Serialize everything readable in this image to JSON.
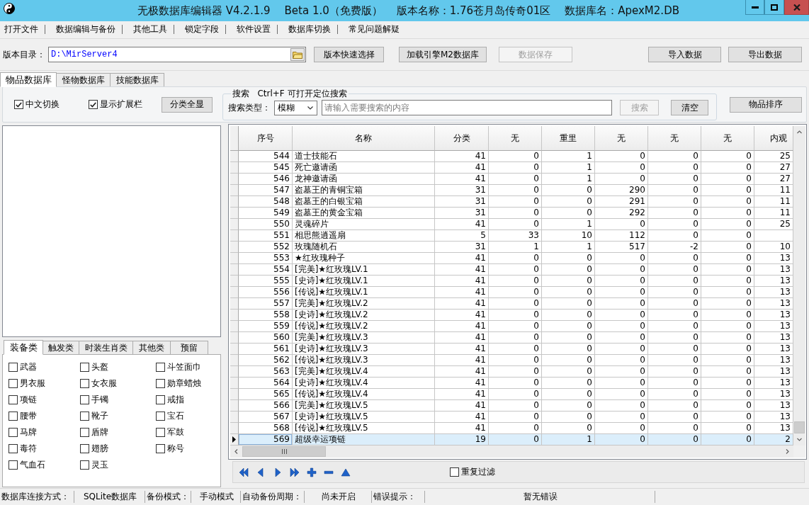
{
  "window": {
    "title": "无极数据库编辑器 V4.2.1.9",
    "edition": "Beta 1.0（免费版）",
    "version_name": "版本名称：1.76苍月岛传奇01区",
    "database_name": "数据库名：ApexM2.DB"
  },
  "menu": [
    "打开文件",
    "数据编辑与备份",
    "其他工具",
    "锁定字段",
    "软件设置",
    "数据库切换",
    "常见问题解疑"
  ],
  "toolbar": {
    "path_label": "版本目录：",
    "path_value": "D:\\MirServer4",
    "left_buttons": [
      {
        "label": "版本快速选择",
        "disabled": false
      },
      {
        "label": "加载引擎M2数据库",
        "disabled": false
      },
      {
        "label": "数据保存",
        "disabled": true
      }
    ],
    "right_buttons": [
      {
        "label": "导入数据",
        "disabled": false
      },
      {
        "label": "导出数据",
        "disabled": false
      }
    ]
  },
  "tabs": [
    {
      "label": "物品数据库",
      "selected": true
    },
    {
      "label": "怪物数据库",
      "selected": false
    },
    {
      "label": "技能数据库",
      "selected": false
    }
  ],
  "options": {
    "checkboxes": [
      {
        "label": "中文切换",
        "checked": true
      },
      {
        "label": "显示扩展栏",
        "checked": true
      }
    ],
    "show_all_button": "分类全显",
    "search": {
      "title": "搜索   Ctrl+F 可打开定位搜索",
      "type_label": "搜索类型：",
      "type_value": "模糊",
      "placeholder": "请输入需要搜索的内容",
      "search_button": {
        "label": "搜索",
        "disabled": true
      },
      "clear_button": {
        "label": "清空",
        "disabled": false
      }
    },
    "sort_button": "物品排序"
  },
  "category_tabs": [
    {
      "label": "装备类",
      "selected": true
    },
    {
      "label": "触发类",
      "selected": false
    },
    {
      "label": "时装生肖类",
      "selected": false
    },
    {
      "label": "其他类",
      "selected": false
    },
    {
      "label": "预留",
      "selected": false
    }
  ],
  "categories": [
    {
      "label": "武器",
      "checked": false
    },
    {
      "label": "头盔",
      "checked": false
    },
    {
      "label": "斗笠面巾",
      "checked": false
    },
    {
      "label": "男衣服",
      "checked": false
    },
    {
      "label": "女衣服",
      "checked": false
    },
    {
      "label": "勋章蜡烛",
      "checked": false
    },
    {
      "label": "项链",
      "checked": false
    },
    {
      "label": "手镯",
      "checked": false
    },
    {
      "label": "戒指",
      "checked": false
    },
    {
      "label": "腰带",
      "checked": false
    },
    {
      "label": "靴子",
      "checked": false
    },
    {
      "label": "宝石",
      "checked": false
    },
    {
      "label": "马牌",
      "checked": false
    },
    {
      "label": "盾牌",
      "checked": false
    },
    {
      "label": "军鼓",
      "checked": false
    },
    {
      "label": "毒符",
      "checked": false
    },
    {
      "label": "翅膀",
      "checked": false
    },
    {
      "label": "称号",
      "checked": false
    },
    {
      "label": "气血石",
      "checked": false
    },
    {
      "label": "灵玉",
      "checked": false
    }
  ],
  "table": {
    "columns": [
      "序号",
      "名称",
      "分类",
      "无",
      "重里",
      "无",
      "无",
      "无",
      "内观"
    ],
    "rows": [
      {
        "cells": [
          "544",
          "道士技能石",
          "41",
          "0",
          "1",
          "0",
          "0",
          "0",
          "25"
        ],
        "selected": false
      },
      {
        "cells": [
          "545",
          "死亡邀请函",
          "41",
          "0",
          "1",
          "0",
          "0",
          "0",
          "27"
        ],
        "selected": false
      },
      {
        "cells": [
          "546",
          "龙神邀请函",
          "41",
          "0",
          "1",
          "0",
          "0",
          "0",
          "27"
        ],
        "selected": false
      },
      {
        "cells": [
          "547",
          "盗墓王的青铜宝箱",
          "31",
          "0",
          "0",
          "290",
          "0",
          "0",
          "11"
        ],
        "selected": false
      },
      {
        "cells": [
          "548",
          "盗墓王的白银宝箱",
          "31",
          "0",
          "0",
          "291",
          "0",
          "0",
          "11"
        ],
        "selected": false
      },
      {
        "cells": [
          "549",
          "盗墓王的黄金宝箱",
          "31",
          "0",
          "0",
          "292",
          "0",
          "0",
          "11"
        ],
        "selected": false
      },
      {
        "cells": [
          "550",
          "灵魂碎片",
          "41",
          "0",
          "1",
          "0",
          "0",
          "0",
          "25"
        ],
        "selected": false
      },
      {
        "cells": [
          "551",
          "相思熊逍遥扇",
          "5",
          "33",
          "10",
          "112",
          "0",
          "0"
        ],
        "selected": false
      },
      {
        "cells": [
          "552",
          "玫瑰随机石",
          "31",
          "1",
          "1",
          "517",
          "-2",
          "0",
          "10"
        ],
        "selected": false
      },
      {
        "cells": [
          "553",
          "★红玫瑰种子",
          "41",
          "0",
          "0",
          "0",
          "0",
          "0",
          "13"
        ],
        "selected": false
      },
      {
        "cells": [
          "554",
          "[完美]★红玫瑰LV.1",
          "41",
          "0",
          "0",
          "0",
          "0",
          "0",
          "13"
        ],
        "selected": false
      },
      {
        "cells": [
          "555",
          "[史诗]★红玫瑰LV.1",
          "41",
          "0",
          "0",
          "0",
          "0",
          "0",
          "13"
        ],
        "selected": false
      },
      {
        "cells": [
          "556",
          "[传说]★红玫瑰LV.1",
          "41",
          "0",
          "0",
          "0",
          "0",
          "0",
          "13"
        ],
        "selected": false
      },
      {
        "cells": [
          "557",
          "[完美]★红玫瑰LV.2",
          "41",
          "0",
          "0",
          "0",
          "0",
          "0",
          "13"
        ],
        "selected": false
      },
      {
        "cells": [
          "558",
          "[史诗]★红玫瑰LV.2",
          "41",
          "0",
          "0",
          "0",
          "0",
          "0",
          "13"
        ],
        "selected": false
      },
      {
        "cells": [
          "559",
          "[传说]★红玫瑰LV.2",
          "41",
          "0",
          "0",
          "0",
          "0",
          "0",
          "13"
        ],
        "selected": false
      },
      {
        "cells": [
          "560",
          "[完美]★红玫瑰LV.3",
          "41",
          "0",
          "0",
          "0",
          "0",
          "0",
          "13"
        ],
        "selected": false
      },
      {
        "cells": [
          "561",
          "[史诗]★红玫瑰LV.3",
          "41",
          "0",
          "0",
          "0",
          "0",
          "0",
          "13"
        ],
        "selected": false
      },
      {
        "cells": [
          "562",
          "[传说]★红玫瑰LV.3",
          "41",
          "0",
          "0",
          "0",
          "0",
          "0",
          "13"
        ],
        "selected": false
      },
      {
        "cells": [
          "563",
          "[完美]★红玫瑰LV.4",
          "41",
          "0",
          "0",
          "0",
          "0",
          "0",
          "13"
        ],
        "selected": false
      },
      {
        "cells": [
          "564",
          "[史诗]★红玫瑰LV.4",
          "41",
          "0",
          "0",
          "0",
          "0",
          "0",
          "13"
        ],
        "selected": false
      },
      {
        "cells": [
          "565",
          "[传说]★红玫瑰LV.4",
          "41",
          "0",
          "0",
          "0",
          "0",
          "0",
          "13"
        ],
        "selected": false
      },
      {
        "cells": [
          "566",
          "[完美]★红玫瑰LV.5",
          "41",
          "0",
          "0",
          "0",
          "0",
          "0",
          "13"
        ],
        "selected": false
      },
      {
        "cells": [
          "567",
          "[史诗]★红玫瑰LV.5",
          "41",
          "0",
          "0",
          "0",
          "0",
          "0",
          "13"
        ],
        "selected": false
      },
      {
        "cells": [
          "568",
          "[传说]★红玫瑰LV.5",
          "41",
          "0",
          "0",
          "0",
          "0",
          "0",
          "13"
        ],
        "selected": false
      },
      {
        "cells": [
          "569",
          "超级幸运项链",
          "19",
          "0",
          "1",
          "0",
          "0",
          "0",
          "2"
        ],
        "selected": true
      }
    ]
  },
  "navigator": {
    "filter": {
      "label": "重复过滤",
      "checked": false
    }
  },
  "status_bar": [
    {
      "label": "数据库连接方式：",
      "value": "SQLite数据库"
    },
    {
      "label": "备份模式：",
      "value": "手动模式"
    },
    {
      "label": "自动备份周期：",
      "value": "尚未开启"
    },
    {
      "label": "错误提示：",
      "value": "暂无错误"
    }
  ]
}
